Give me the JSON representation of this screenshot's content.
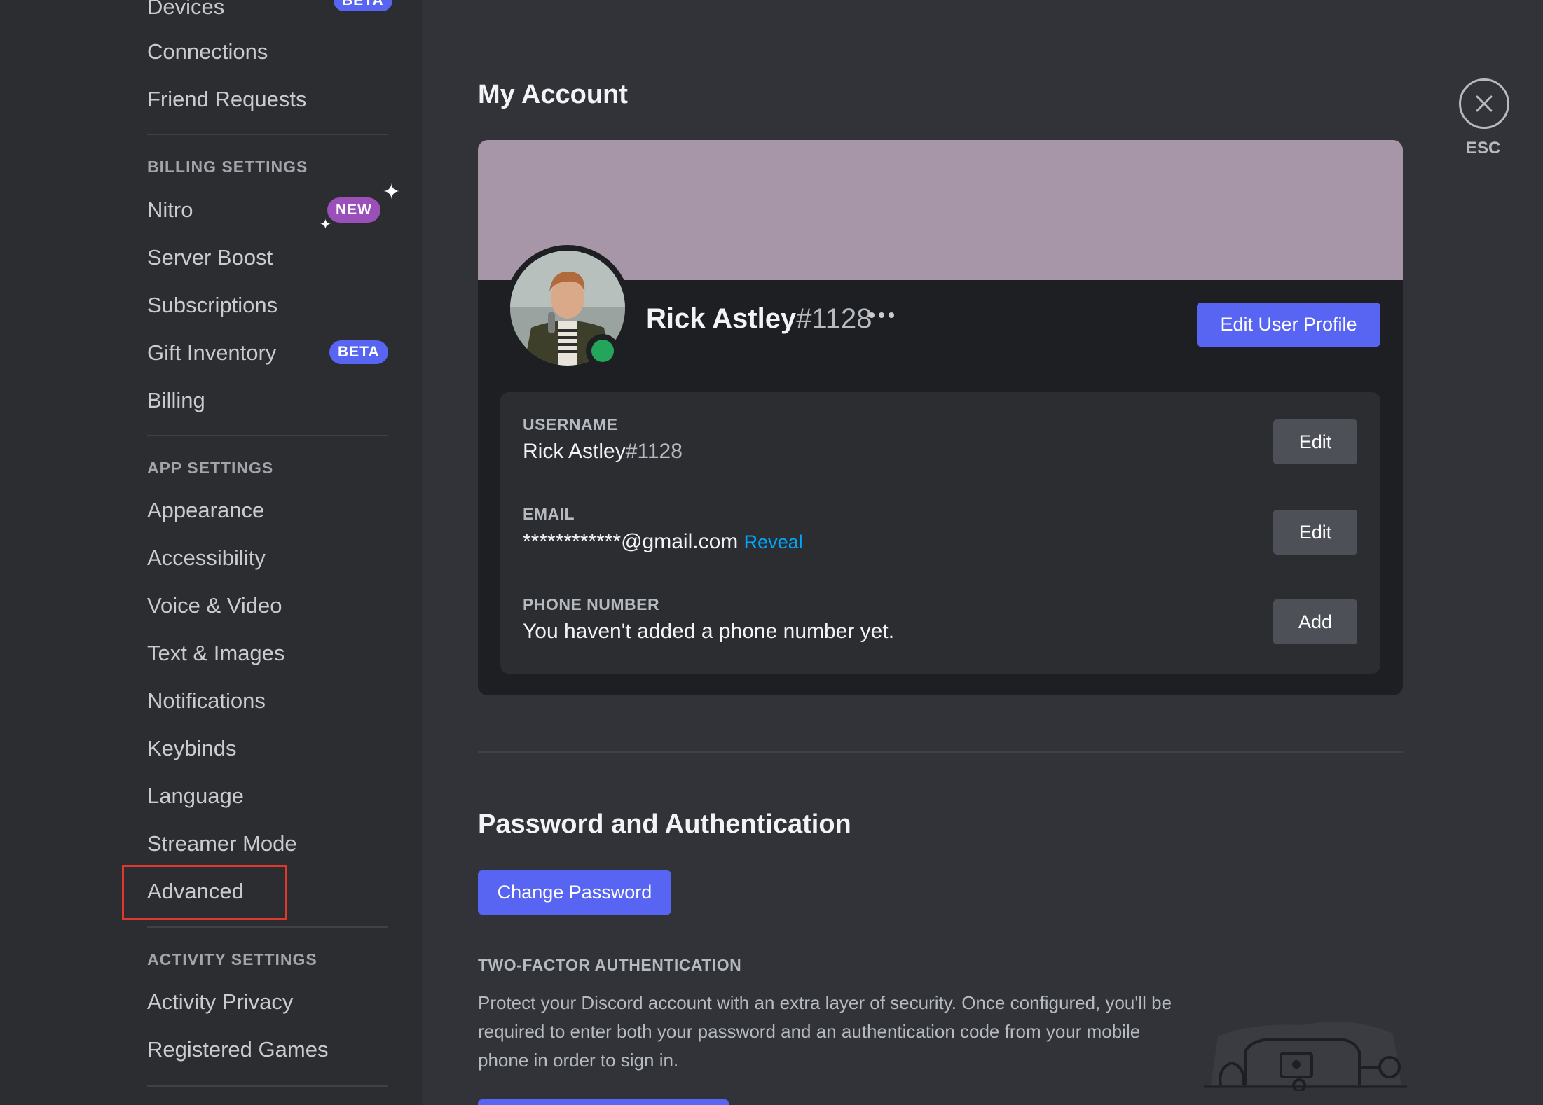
{
  "sidebar": {
    "user_settings": {
      "devices": {
        "label": "Devices",
        "badge": "BETA"
      },
      "connections": "Connections",
      "friend_requests": "Friend Requests"
    },
    "billing_header": "BILLING SETTINGS",
    "billing": {
      "nitro": {
        "label": "Nitro",
        "badge": "NEW"
      },
      "server_boost": "Server Boost",
      "subscriptions": "Subscriptions",
      "gift_inventory": {
        "label": "Gift Inventory",
        "badge": "BETA"
      },
      "billing": "Billing"
    },
    "app_header": "APP SETTINGS",
    "app": {
      "appearance": "Appearance",
      "accessibility": "Accessibility",
      "voice_video": "Voice & Video",
      "text_images": "Text & Images",
      "notifications": "Notifications",
      "keybinds": "Keybinds",
      "language": "Language",
      "streamer_mode": "Streamer Mode",
      "advanced": "Advanced"
    },
    "activity_header": "ACTIVITY SETTINGS",
    "activity": {
      "activity_privacy": "Activity Privacy",
      "registered_games": "Registered Games"
    }
  },
  "main": {
    "title": "My Account",
    "close_label": "ESC",
    "profile": {
      "name": "Rick Astley",
      "discriminator": "#1128",
      "edit_profile_label": "Edit User Profile"
    },
    "fields": {
      "username": {
        "label": "USERNAME",
        "name": "Rick Astley",
        "discriminator": "#1128",
        "button": "Edit"
      },
      "email": {
        "label": "EMAIL",
        "value": "************@gmail.com",
        "reveal": "Reveal",
        "button": "Edit"
      },
      "phone": {
        "label": "PHONE NUMBER",
        "value": "You haven't added a phone number yet.",
        "button": "Add"
      }
    },
    "password_section": {
      "title": "Password and Authentication",
      "change_password_label": "Change Password",
      "tfa_label": "TWO-FACTOR AUTHENTICATION",
      "tfa_description": "Protect your Discord account with an extra layer of security. Once configured, you'll be required to enter both your password and an authentication code from your mobile phone in order to sign in."
    }
  },
  "colors": {
    "background": "#313338",
    "sidebar": "#2b2d31",
    "card": "#1e1f22",
    "banner": "#a796a8",
    "accent": "#5865f2",
    "online": "#23a55a",
    "link": "#00a8fc",
    "highlight": "#e0382f"
  },
  "icons": {
    "close": "close-icon",
    "more": "more-icon",
    "sparkle": "sparkle-icon",
    "status": "online-status-icon"
  }
}
